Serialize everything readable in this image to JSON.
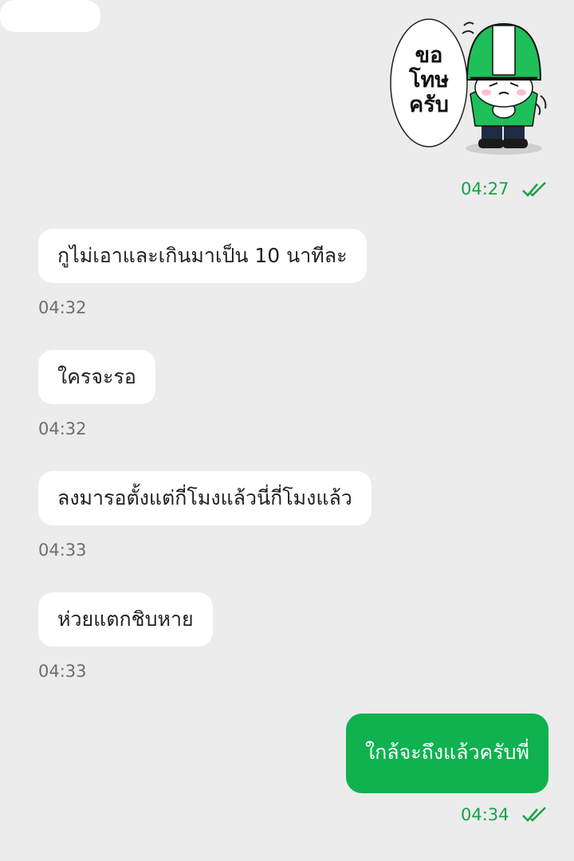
{
  "sticker": {
    "caption_lines": [
      "ขอ",
      "โทษ",
      "ครับ"
    ],
    "colors": {
      "helmet_green": "#1fbf5a",
      "helmet_white": "#ffffff",
      "outline": "#111111"
    }
  },
  "messages": [
    {
      "direction": "outgoing",
      "type": "sticker",
      "time": "04:27",
      "status": "double-check-icon"
    },
    {
      "direction": "incoming",
      "text": "กูไม่เอาและเกินมาเป็น 10 นาทีละ",
      "time": "04:32"
    },
    {
      "direction": "incoming",
      "text": "ใครจะรอ",
      "time": "04:32"
    },
    {
      "direction": "incoming",
      "text": "ลงมารอตั้งแต่กี่โมงแล้วนี่กี่โมงแล้ว",
      "time": "04:33"
    },
    {
      "direction": "incoming",
      "text": "ห่วยแตกชิบหาย",
      "time": "04:33"
    },
    {
      "direction": "outgoing",
      "text": "ใกล้จะถึงแล้วครับพี่",
      "time": "04:34",
      "status": "double-check-icon"
    }
  ],
  "colors": {
    "background": "#ececec",
    "incoming_bubble": "#ffffff",
    "outgoing_bubble": "#0fb24f",
    "outgoing_time": "#16a34a",
    "incoming_time": "#6e6e6e"
  }
}
